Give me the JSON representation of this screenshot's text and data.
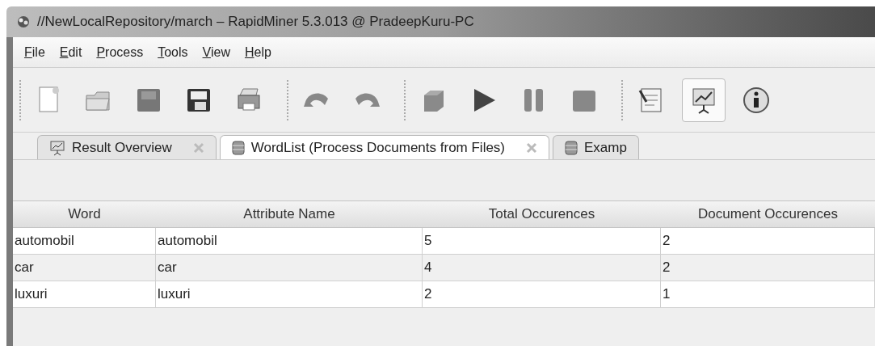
{
  "window": {
    "title": "//NewLocalRepository/march – RapidMiner 5.3.013 @ PradeepKuru-PC"
  },
  "menu": [
    "File",
    "Edit",
    "Process",
    "Tools",
    "View",
    "Help"
  ],
  "toolbar": {
    "groups": [
      {
        "items": [
          {
            "kind": "new",
            "selected": false
          },
          {
            "kind": "open",
            "selected": false
          },
          {
            "kind": "save",
            "selected": false
          },
          {
            "kind": "saveas",
            "selected": false
          },
          {
            "kind": "print",
            "selected": false
          }
        ]
      },
      {
        "items": [
          {
            "kind": "undo",
            "selected": false
          },
          {
            "kind": "redo",
            "selected": false
          }
        ]
      },
      {
        "items": [
          {
            "kind": "cube",
            "selected": false
          },
          {
            "kind": "run",
            "selected": false
          },
          {
            "kind": "pause",
            "selected": false
          },
          {
            "kind": "stop",
            "selected": false
          }
        ]
      },
      {
        "items": [
          {
            "kind": "notes",
            "selected": false
          },
          {
            "kind": "results",
            "selected": true
          },
          {
            "kind": "info",
            "selected": false
          }
        ]
      }
    ]
  },
  "tabs": [
    {
      "label": "Result Overview",
      "kind": "chart",
      "closable": true,
      "selected": false
    },
    {
      "label": "WordList (Process Documents from Files)",
      "kind": "data",
      "closable": true,
      "selected": true
    },
    {
      "label": "Examp",
      "kind": "data",
      "closable": false,
      "selected": false
    }
  ],
  "table": {
    "columns": [
      "Word",
      "Attribute Name",
      "Total Occurences",
      "Document Occurences"
    ],
    "rows": [
      [
        "automobil",
        "automobil",
        "5",
        "2"
      ],
      [
        "car",
        "car",
        "4",
        "2"
      ],
      [
        "luxuri",
        "luxuri",
        "2",
        "1"
      ]
    ]
  }
}
